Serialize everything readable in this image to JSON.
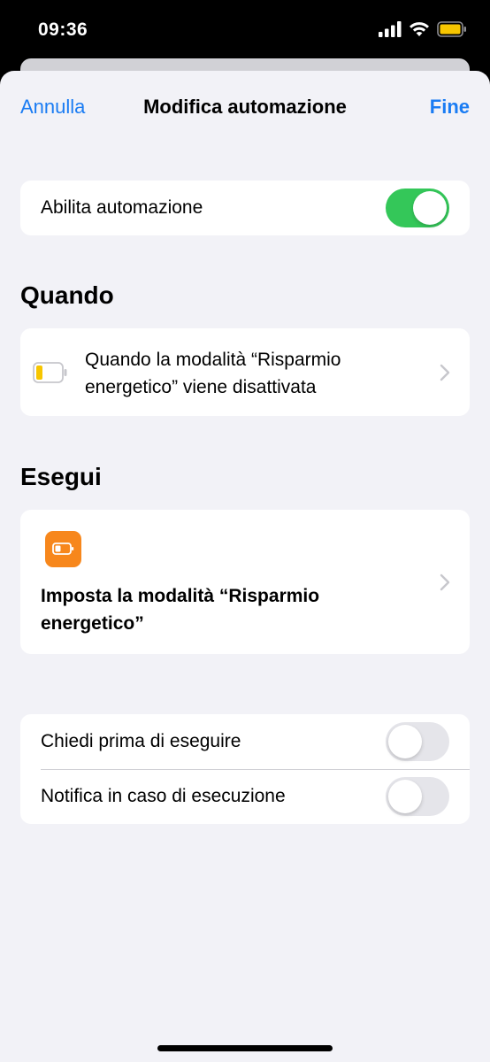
{
  "status_bar": {
    "time": "09:36",
    "icons": [
      "signal-icon",
      "wifi-icon",
      "battery-icon"
    ],
    "battery_color": "#f7c600"
  },
  "nav": {
    "cancel_label": "Annulla",
    "title": "Modifica automazione",
    "done_label": "Fine"
  },
  "enable": {
    "label": "Abilita automazione",
    "on": true
  },
  "when": {
    "title": "Quando",
    "trigger_line1": "Quando la modalità “Risparmio",
    "trigger_line2": "energetico” viene disattivata",
    "icon": "low-battery-icon"
  },
  "run": {
    "title": "Esegui",
    "action_line1": "Imposta la modalità “Risparmio",
    "action_line2": "energetico”",
    "icon": "battery-action-icon",
    "icon_color": "#f7871c"
  },
  "options": {
    "ask_label": "Chiedi prima di eseguire",
    "ask_on": false,
    "notify_label": "Notifica in caso di esecuzione",
    "notify_on": false
  },
  "colors": {
    "accent": "#1a7cf3",
    "toggle_on": "#34c759",
    "background": "#f2f2f7"
  }
}
